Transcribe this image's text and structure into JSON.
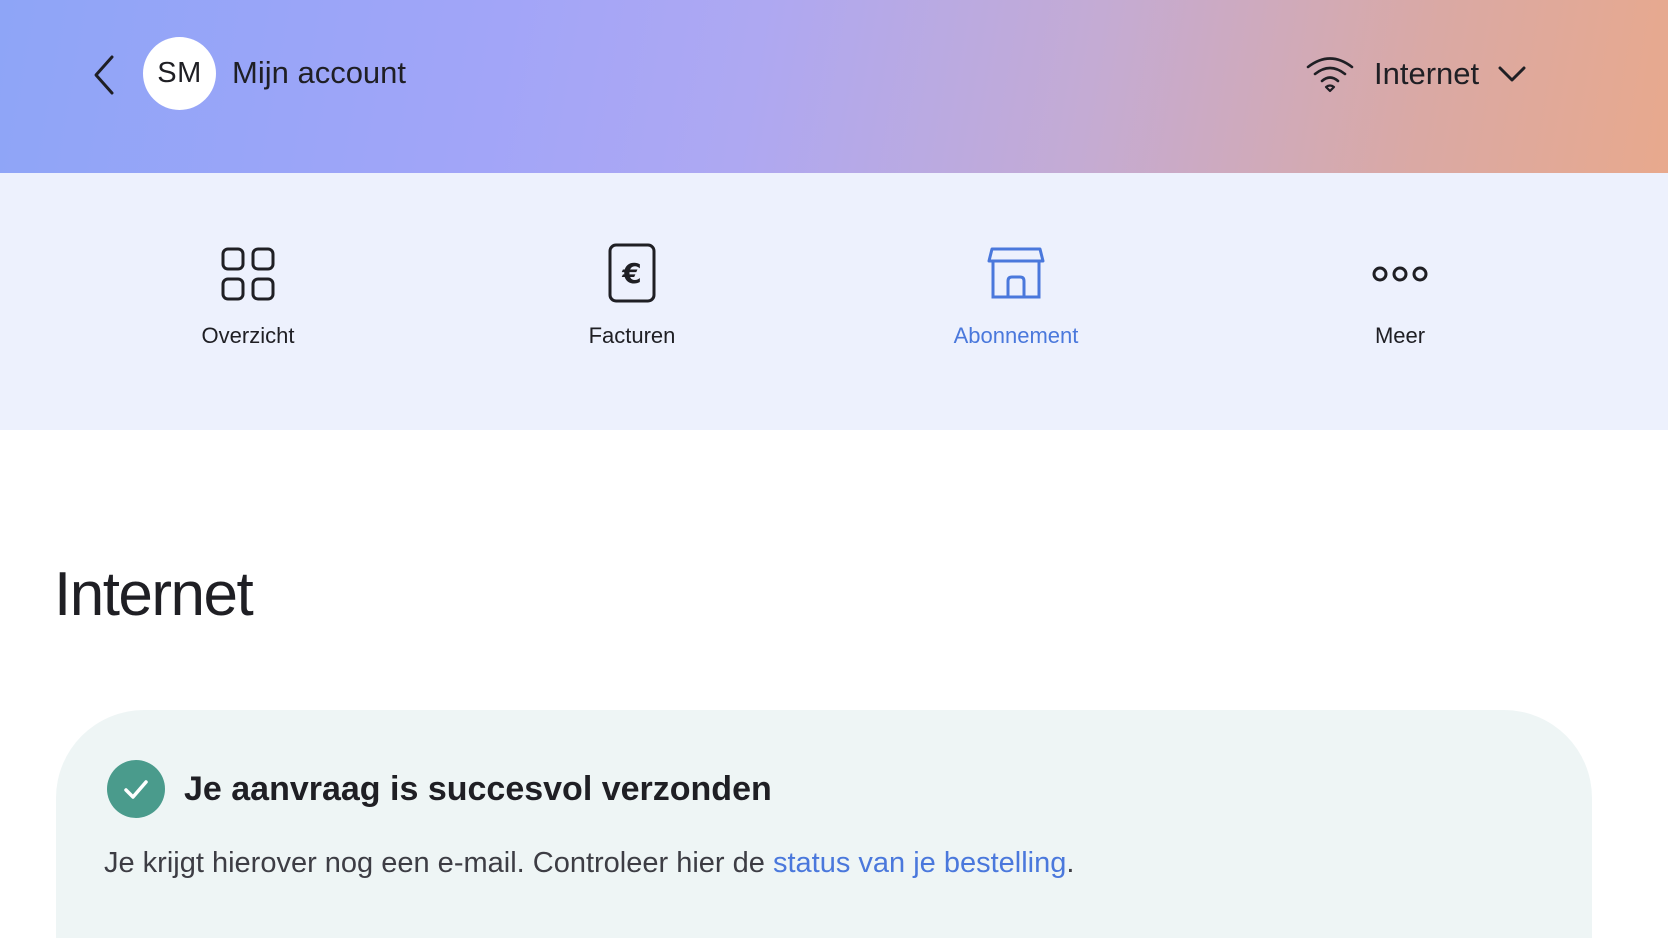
{
  "header": {
    "avatar_initials": "SM",
    "title": "Mijn account",
    "service_label": "Internet",
    "icons": {
      "back": "chevron-left-icon",
      "service": "wifi-icon",
      "dropdown": "chevron-down-icon"
    }
  },
  "nav": {
    "items": [
      {
        "label": "Overzicht",
        "icon": "grid-icon",
        "active": false
      },
      {
        "label": "Facturen",
        "icon": "euro-invoice-icon",
        "active": false
      },
      {
        "label": "Abonnement",
        "icon": "store-icon",
        "active": true
      },
      {
        "label": "Meer",
        "icon": "more-dots-icon",
        "active": false
      }
    ]
  },
  "main": {
    "title": "Internet",
    "notice": {
      "title": "Je aanvraag is succesvol verzonden",
      "text_before": "Je krijgt hierover nog een e-mail. Controleer hier de ",
      "link_text": "status van je bestelling",
      "text_after": "."
    }
  },
  "colors": {
    "accent": "#4a78dc",
    "success": "#4a9b8c",
    "nav_bg": "#edf1fd",
    "notice_bg": "#eef5f5"
  }
}
